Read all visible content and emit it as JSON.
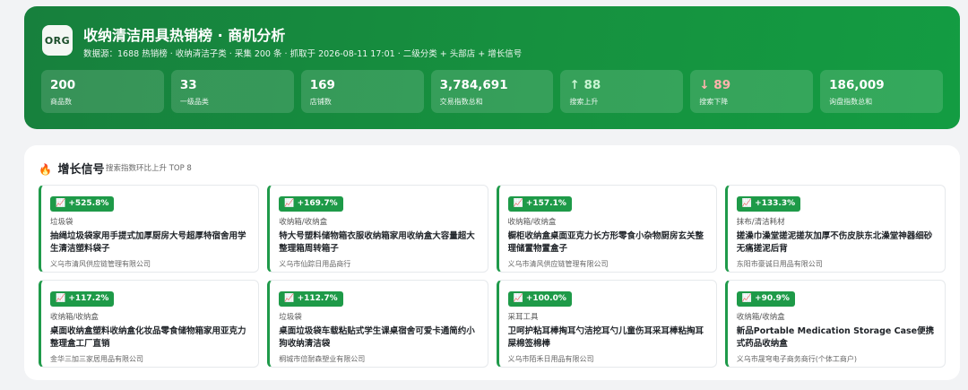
{
  "header": {
    "logo": "ORG",
    "title": "收纳清洁用具热销榜 · 商机分析",
    "subtitle": "数据源：1688 热销榜 · 收纳清洁子类 · 采集 200 条 · 抓取于 2026-08-11 17:01 · 二级分类 + 头部店 + 增长信号"
  },
  "stats": [
    {
      "value": "200",
      "label": "商品数"
    },
    {
      "value": "33",
      "label": "一级品类"
    },
    {
      "value": "169",
      "label": "店铺数"
    },
    {
      "value": "3,784,691",
      "label": "交易指数总和"
    },
    {
      "value": "↑ 88",
      "label": "搜索上升"
    },
    {
      "value": "↓ 89",
      "label": "搜索下降"
    },
    {
      "value": "186,009",
      "label": "询盘指数总和"
    }
  ],
  "section": {
    "icon": "fire-icon",
    "emoji": "🔥",
    "title": "增长信号",
    "subtitle": "搜索指数环比上升 TOP 8"
  },
  "cards": [
    {
      "growth": "📈 +525.8%",
      "category": "垃圾袋",
      "name": "抽绳垃圾袋家用手提式加厚厨房大号超厚特宿舍用学生清洁塑料袋子",
      "shop": "义乌市清风供应链管理有限公司"
    },
    {
      "growth": "📈 +169.7%",
      "category": "收纳箱/收纳盒",
      "name": "特大号塑料储物箱衣服收纳箱家用收纳盒大容量超大整理箱周转箱子",
      "shop": "义乌市仙踪日用品商行"
    },
    {
      "growth": "📈 +157.1%",
      "category": "收纳箱/收纳盒",
      "name": "橱柜收纳盒桌面亚克力长方形零食小杂物厨房玄关整理储置物置盒子",
      "shop": "义乌市清风供应链管理有限公司"
    },
    {
      "growth": "📈 +133.3%",
      "category": "抹布/清洁耗材",
      "name": "搓澡巾澡堂搓泥搓灰加厚不伤皮肤东北澡堂神器细砂无痛搓泥后背",
      "shop": "东阳市豪诚日用品有限公司"
    },
    {
      "growth": "📈 +117.2%",
      "category": "收纳箱/收纳盒",
      "name": "桌面收纳盒塑料收纳盒化妆品零食储物箱家用亚克力整理盒工厂直销",
      "shop": "金华三加三家居用品有限公司"
    },
    {
      "growth": "📈 +112.7%",
      "category": "垃圾袋",
      "name": "桌面垃圾袋车载粘贴式学生课桌宿舍可爱卡通简约小狗收纳清洁袋",
      "shop": "桐城市倍耐森塑业有限公司"
    },
    {
      "growth": "📈 +100.0%",
      "category": "采耳工具",
      "name": "卫呵护粘耳棒掏耳勺洁挖耳勺儿童伤耳采耳棒粘掏耳屎棉签棉棒",
      "shop": "义乌市陌禾日用品有限公司"
    },
    {
      "growth": "📈 +90.9%",
      "category": "收纳箱/收纳盒",
      "name": "新品Portable Medication Storage Case便携式药品收纳盒",
      "shop": "义乌市晟穹电子商务商行(个体工商户)"
    }
  ],
  "colors": {
    "brand_green": "#16913f",
    "badge_green": "#1e9a48",
    "up": "#c8f5d2",
    "down": "#ffb3ad"
  }
}
